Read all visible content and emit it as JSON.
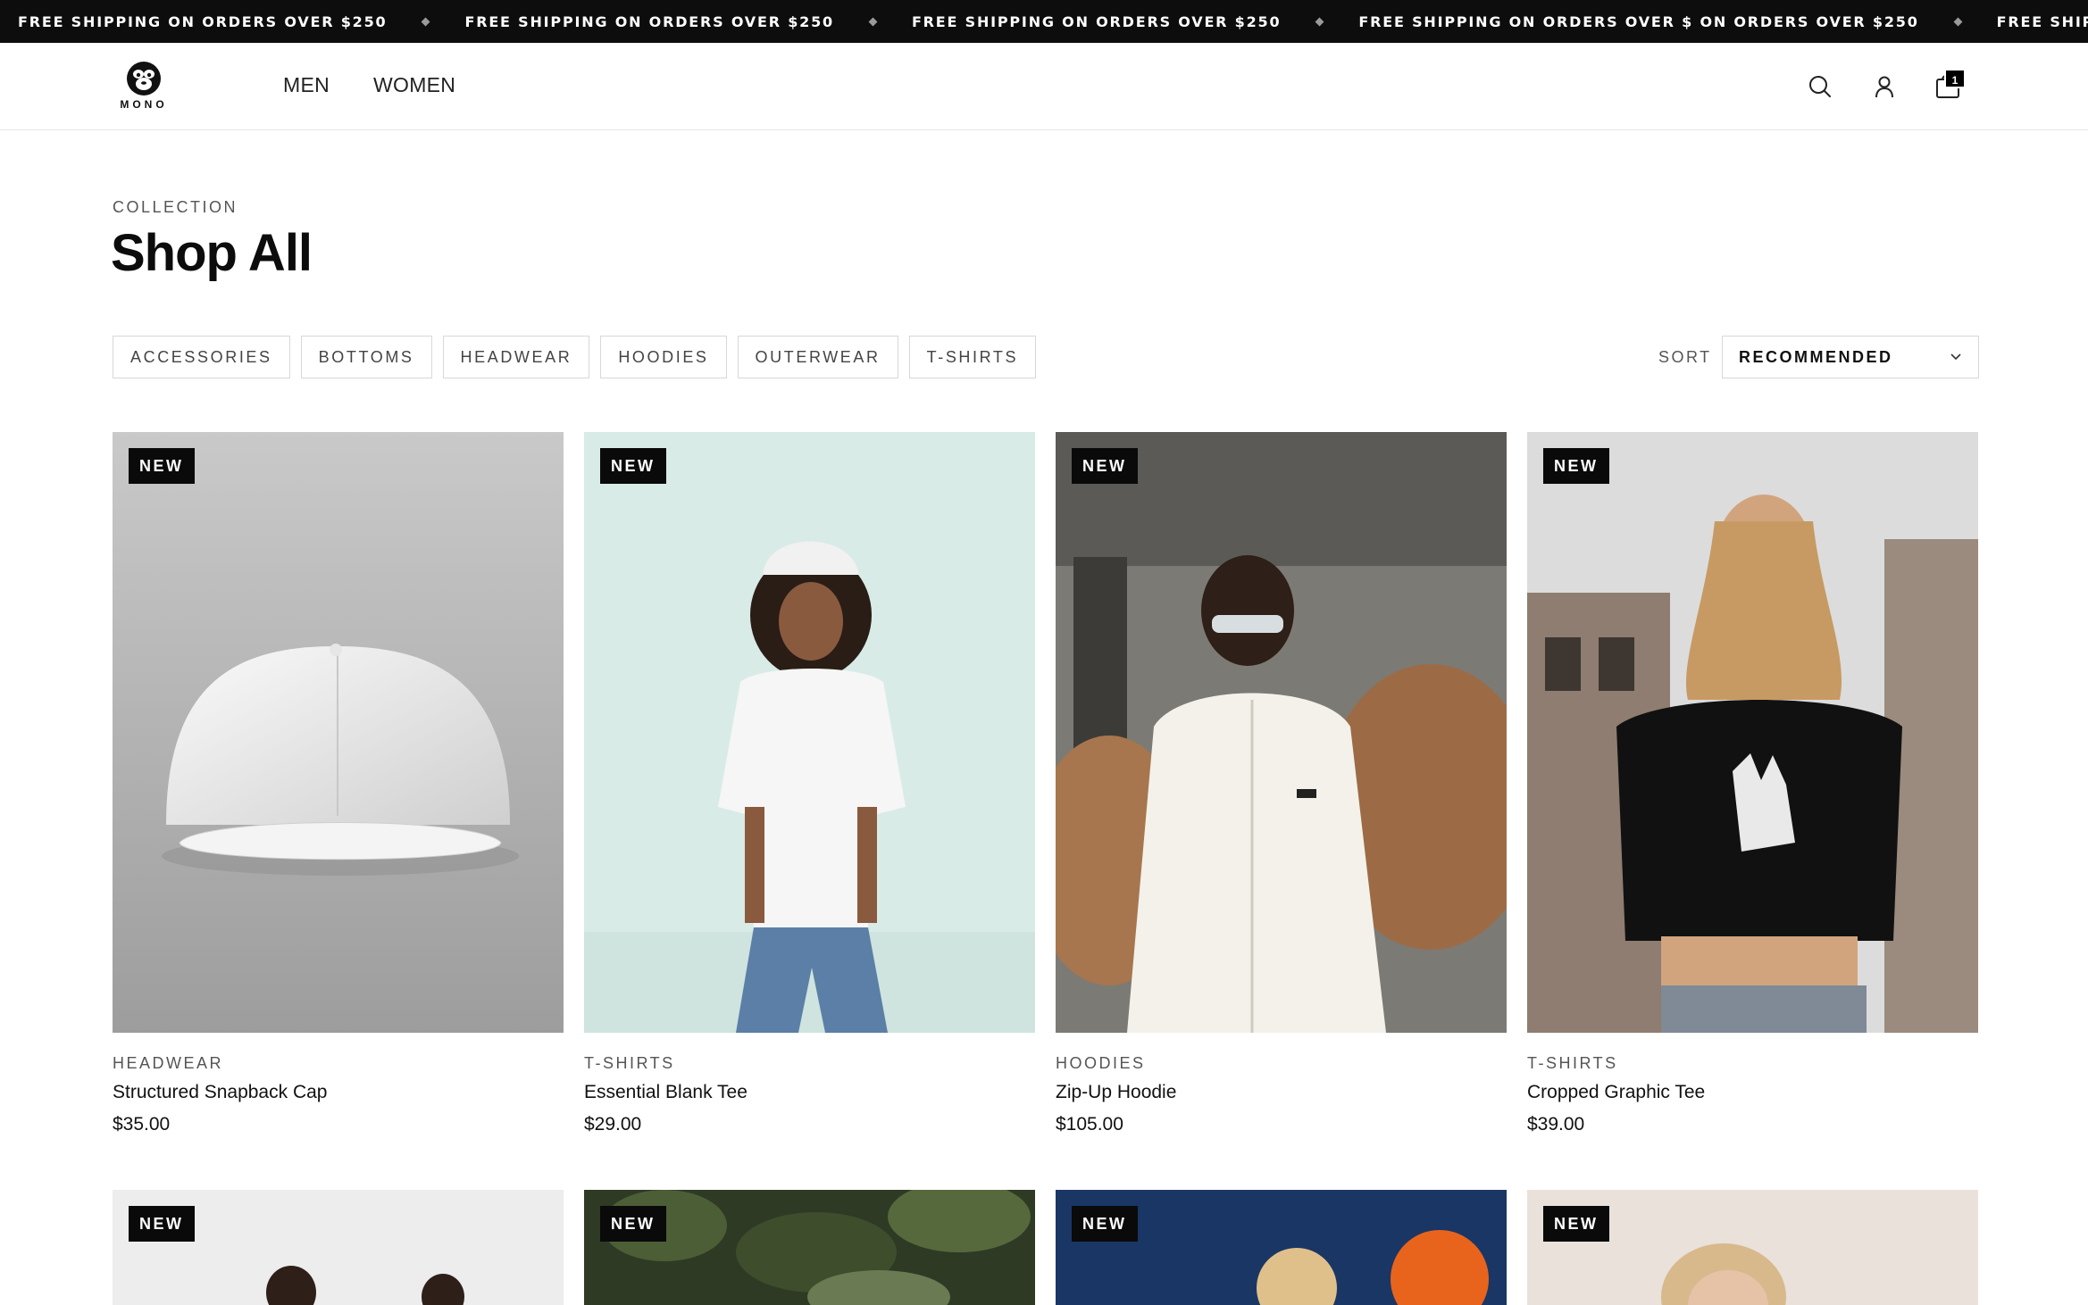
{
  "announcement": {
    "messages": [
      "FREE SHIPPING ON ORDERS OVER $250",
      "FREE SHIPPING ON ORDERS OVER $250",
      "FREE SHIPPING ON ORDERS OVER $250",
      "FREE SHIPPING ON ORDERS OVER $ ON ORDERS OVER $250",
      "FREE SHIPPING ON OF"
    ]
  },
  "header": {
    "logo_text": "MONO",
    "nav": [
      "MEN",
      "WOMEN"
    ],
    "cart_count": "1",
    "icons": [
      "search-icon",
      "account-icon",
      "cart-icon"
    ]
  },
  "collection": {
    "eyebrow": "COLLECTION",
    "title": "Shop All"
  },
  "filters": [
    "ACCESSORIES",
    "BOTTOMS",
    "HEADWEAR",
    "HOODIES",
    "OUTERWEAR",
    "T-SHIRTS"
  ],
  "sort": {
    "label": "SORT",
    "value": "RECOMMENDED"
  },
  "products": [
    {
      "badge": "NEW",
      "category": "HEADWEAR",
      "name": "Structured Snapback Cap",
      "price": "$35.00"
    },
    {
      "badge": "NEW",
      "category": "T-SHIRTS",
      "name": "Essential Blank Tee",
      "price": "$29.00"
    },
    {
      "badge": "NEW",
      "category": "HOODIES",
      "name": "Zip-Up Hoodie",
      "price": "$105.00"
    },
    {
      "badge": "NEW",
      "category": "T-SHIRTS",
      "name": "Cropped Graphic Tee",
      "price": "$39.00"
    }
  ],
  "products_row2": [
    {
      "badge": "NEW"
    },
    {
      "badge": "NEW"
    },
    {
      "badge": "NEW"
    },
    {
      "badge": "NEW"
    }
  ],
  "colors": {
    "announcement_bg": "#0d0d0d",
    "badge_bg": "#0a0a0a",
    "border": "#d8d8d8"
  }
}
